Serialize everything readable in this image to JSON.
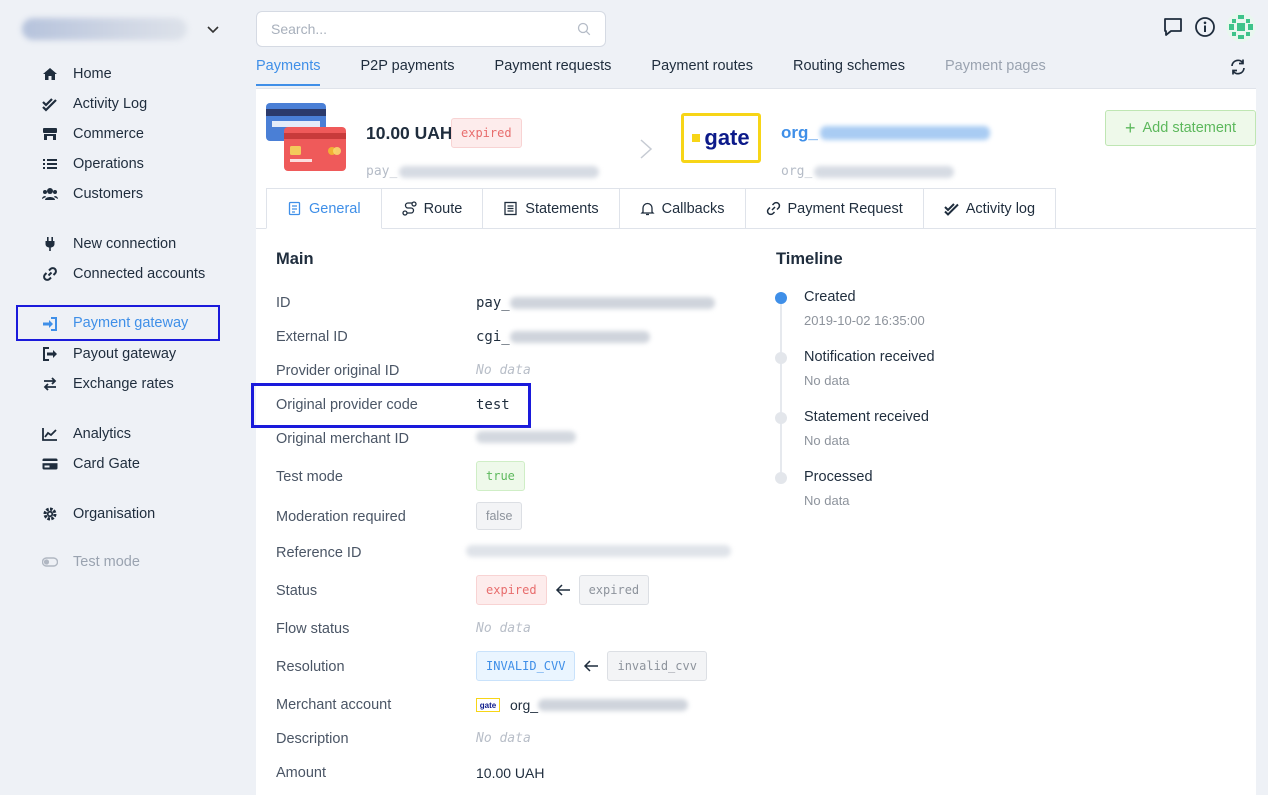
{
  "sidebar": {
    "org_switcher": {
      "icon": "chevron-down-icon"
    },
    "items": [
      {
        "label": "Home",
        "icon": "home-icon"
      },
      {
        "label": "Activity Log",
        "icon": "double-check-icon"
      },
      {
        "label": "Commerce",
        "icon": "store-icon"
      },
      {
        "label": "Operations",
        "icon": "list-icon"
      },
      {
        "label": "Customers",
        "icon": "users-icon"
      },
      {
        "label": "New connection",
        "icon": "plug-icon"
      },
      {
        "label": "Connected accounts",
        "icon": "link-icon"
      },
      {
        "label": "Payment gateway",
        "icon": "sign-in-icon"
      },
      {
        "label": "Payout gateway",
        "icon": "sign-out-icon"
      },
      {
        "label": "Exchange rates",
        "icon": "exchange-icon"
      },
      {
        "label": "Analytics",
        "icon": "line-chart-icon"
      },
      {
        "label": "Card Gate",
        "icon": "credit-card-icon"
      },
      {
        "label": "Organisation",
        "icon": "gear-icon"
      },
      {
        "label": "Test mode",
        "icon": "toggle-icon"
      }
    ]
  },
  "search": {
    "placeholder": "Search..."
  },
  "top_tabs": [
    "Payments",
    "P2P payments",
    "Payment requests",
    "Payment routes",
    "Routing schemes",
    "Payment pages"
  ],
  "payment": {
    "amount": "10.00 UAH",
    "status_badge": "expired",
    "id_prefix": "pay_",
    "gate_logo_text": "gate",
    "org_prefix": "org_",
    "add_statement": "Add statement"
  },
  "detail_tabs": [
    "General",
    "Route",
    "Statements",
    "Callbacks",
    "Payment Request",
    "Activity log"
  ],
  "main": {
    "title": "Main",
    "rows": {
      "id": {
        "label": "ID",
        "value": "pay_"
      },
      "external_id": {
        "label": "External ID",
        "value": "cgi_"
      },
      "provider_original_id": {
        "label": "Provider original ID",
        "value": "No data"
      },
      "original_provider_code": {
        "label": "Original provider code",
        "value": "test"
      },
      "original_merchant_id": {
        "label": "Original merchant ID"
      },
      "test_mode": {
        "label": "Test mode",
        "value": "true"
      },
      "moderation_required": {
        "label": "Moderation required",
        "value": "false"
      },
      "reference_id": {
        "label": "Reference ID"
      },
      "status": {
        "label": "Status",
        "value": "expired",
        "previous": "expired"
      },
      "flow_status": {
        "label": "Flow status",
        "value": "No data"
      },
      "resolution": {
        "label": "Resolution",
        "value": "INVALID_CVV",
        "previous": "invalid_cvv"
      },
      "merchant_account": {
        "label": "Merchant account",
        "logo_text": "gate",
        "value": "org_"
      },
      "description": {
        "label": "Description",
        "value": "No data"
      },
      "amount": {
        "label": "Amount",
        "value": "10.00 UAH"
      }
    }
  },
  "timeline": {
    "title": "Timeline",
    "events": [
      {
        "title": "Created",
        "sub": "2019-10-02 16:35:00"
      },
      {
        "title": "Notification received",
        "sub": "No data"
      },
      {
        "title": "Statement received",
        "sub": "No data"
      },
      {
        "title": "Processed",
        "sub": "No data"
      }
    ]
  },
  "colors": {
    "accent": "#3f8fe8",
    "highlight_box": "#1a1adb",
    "danger": "#e86d6d",
    "success": "#5cb85c"
  }
}
